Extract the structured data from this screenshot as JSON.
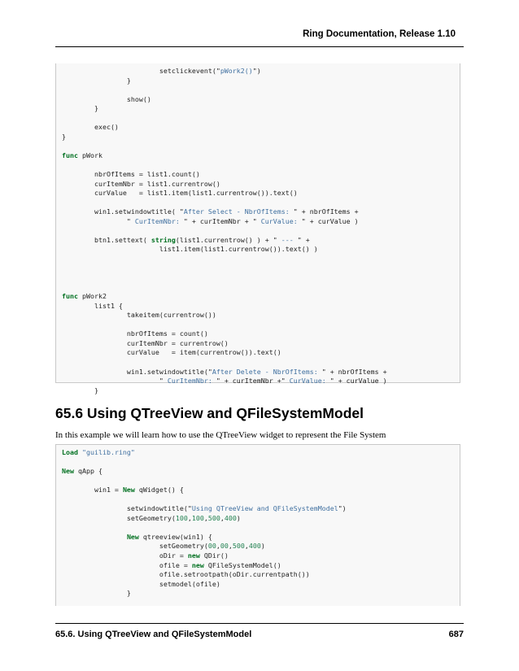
{
  "header": {
    "title": "Ring Documentation, Release 1.10"
  },
  "code_block_1": {
    "lines": [
      [
        {
          "t": "                        setclickevent(\""
        },
        {
          "t": "pWork2()",
          "c": "st"
        },
        {
          "t": "\")"
        }
      ],
      [
        {
          "t": "                }"
        }
      ],
      [
        {
          "t": ""
        }
      ],
      [
        {
          "t": "                show()"
        }
      ],
      [
        {
          "t": "        }"
        }
      ],
      [
        {
          "t": ""
        }
      ],
      [
        {
          "t": "        exec()"
        }
      ],
      [
        {
          "t": "}"
        }
      ],
      [
        {
          "t": ""
        }
      ],
      [
        {
          "t": "func",
          "c": "kw"
        },
        {
          "t": " pWork"
        }
      ],
      [
        {
          "t": ""
        }
      ],
      [
        {
          "t": "        nbrOfItems = list1.count()"
        }
      ],
      [
        {
          "t": "        curItemNbr = list1.currentrow()"
        }
      ],
      [
        {
          "t": "        curValue   = list1.item(list1.currentrow()).text()"
        }
      ],
      [
        {
          "t": ""
        }
      ],
      [
        {
          "t": "        win1.setwindowtitle( \""
        },
        {
          "t": "After Select - NbrOfItems: ",
          "c": "st"
        },
        {
          "t": "\" + nbrOfItems +"
        }
      ],
      [
        {
          "t": "                \""
        },
        {
          "t": " CurItemNbr: ",
          "c": "st"
        },
        {
          "t": "\" + curItemNbr + \""
        },
        {
          "t": " CurValue: ",
          "c": "st"
        },
        {
          "t": "\" + curValue )"
        }
      ],
      [
        {
          "t": ""
        }
      ],
      [
        {
          "t": "        btn1.settext( "
        },
        {
          "t": "string",
          "c": "kw"
        },
        {
          "t": "(list1.currentrow() ) + \""
        },
        {
          "t": " --- ",
          "c": "st"
        },
        {
          "t": "\" +"
        }
      ],
      [
        {
          "t": "                        list1.item(list1.currentrow()).text() )"
        }
      ],
      [
        {
          "t": ""
        }
      ],
      [
        {
          "t": ""
        }
      ],
      [
        {
          "t": ""
        }
      ],
      [
        {
          "t": ""
        }
      ],
      [
        {
          "t": "func",
          "c": "kw"
        },
        {
          "t": " pWork2"
        }
      ],
      [
        {
          "t": "        list1 {"
        }
      ],
      [
        {
          "t": "                takeitem(currentrow())"
        }
      ],
      [
        {
          "t": ""
        }
      ],
      [
        {
          "t": "                nbrOfItems = count()"
        }
      ],
      [
        {
          "t": "                curItemNbr = currentrow()"
        }
      ],
      [
        {
          "t": "                curValue   = item(currentrow()).text()"
        }
      ],
      [
        {
          "t": ""
        }
      ],
      [
        {
          "t": "                win1.setwindowtitle(\""
        },
        {
          "t": "After Delete - NbrOfItems: ",
          "c": "st"
        },
        {
          "t": "\" + nbrOfItems +"
        }
      ],
      [
        {
          "t": "                        \""
        },
        {
          "t": " CurItemNbr: ",
          "c": "st"
        },
        {
          "t": "\" + curItemNbr +\""
        },
        {
          "t": " CurValue: ",
          "c": "st"
        },
        {
          "t": "\" + curValue )"
        }
      ],
      [
        {
          "t": "        }"
        }
      ]
    ]
  },
  "section": {
    "title": "65.6 Using QTreeView and QFileSystemModel",
    "paragraph": "In this example we will learn how to use the QTreeView widget to represent the File System"
  },
  "code_block_2": {
    "lines": [
      [
        {
          "t": "Load",
          "c": "kw"
        },
        {
          "t": " "
        },
        {
          "t": "\"guilib.ring\"",
          "c": "st"
        }
      ],
      [
        {
          "t": ""
        }
      ],
      [
        {
          "t": "New",
          "c": "kw"
        },
        {
          "t": " qApp {"
        }
      ],
      [
        {
          "t": ""
        }
      ],
      [
        {
          "t": "        win1 = "
        },
        {
          "t": "New",
          "c": "kw"
        },
        {
          "t": " qWidget() {"
        }
      ],
      [
        {
          "t": ""
        }
      ],
      [
        {
          "t": "                setwindowtitle(\""
        },
        {
          "t": "Using QTreeView and QFileSystemModel",
          "c": "st"
        },
        {
          "t": "\")"
        }
      ],
      [
        {
          "t": "                setGeometry("
        },
        {
          "t": "100",
          "c": "nm"
        },
        {
          "t": ","
        },
        {
          "t": "100",
          "c": "nm"
        },
        {
          "t": ","
        },
        {
          "t": "500",
          "c": "nm"
        },
        {
          "t": ","
        },
        {
          "t": "400",
          "c": "nm"
        },
        {
          "t": ")"
        }
      ],
      [
        {
          "t": ""
        }
      ],
      [
        {
          "t": "                "
        },
        {
          "t": "New",
          "c": "kw"
        },
        {
          "t": " qtreeview(win1) {"
        }
      ],
      [
        {
          "t": "                        setGeometry("
        },
        {
          "t": "00",
          "c": "nm"
        },
        {
          "t": ","
        },
        {
          "t": "00",
          "c": "nm"
        },
        {
          "t": ","
        },
        {
          "t": "500",
          "c": "nm"
        },
        {
          "t": ","
        },
        {
          "t": "400",
          "c": "nm"
        },
        {
          "t": ")"
        }
      ],
      [
        {
          "t": "                        oDir = "
        },
        {
          "t": "new",
          "c": "kw"
        },
        {
          "t": " QDir()"
        }
      ],
      [
        {
          "t": "                        ofile = "
        },
        {
          "t": "new",
          "c": "kw"
        },
        {
          "t": " QFileSystemModel()"
        }
      ],
      [
        {
          "t": "                        ofile.setrootpath(oDir.currentpath())"
        }
      ],
      [
        {
          "t": "                        setmodel(ofile)"
        }
      ],
      [
        {
          "t": "                }"
        }
      ]
    ]
  },
  "footer": {
    "section_label": "65.6. Using QTreeView and QFileSystemModel",
    "page_number": "687"
  }
}
